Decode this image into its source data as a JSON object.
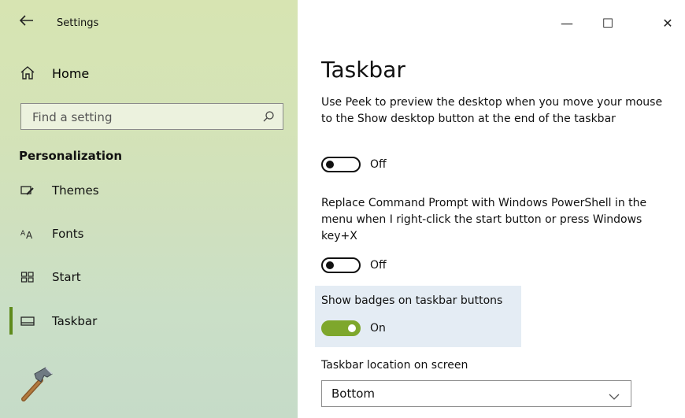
{
  "window": {
    "title": "Settings",
    "controls": {
      "minimize": "—",
      "maximize": "☐",
      "close": "✕"
    }
  },
  "sidebar": {
    "home_label": "Home",
    "search": {
      "placeholder": "Find a setting",
      "value": ""
    },
    "section_title": "Personalization",
    "items": [
      {
        "label": "Themes",
        "icon": "themes-icon"
      },
      {
        "label": "Fonts",
        "icon": "fonts-icon"
      },
      {
        "label": "Start",
        "icon": "start-icon"
      },
      {
        "label": "Taskbar",
        "icon": "taskbar-icon",
        "selected": true
      }
    ]
  },
  "main": {
    "title": "Taskbar",
    "settings": [
      {
        "description": "Use Peek to preview the desktop when you move your mouse to the Show desktop button at the end of the taskbar",
        "state": "Off",
        "on": false
      },
      {
        "description": "Replace Command Prompt with Windows PowerShell in the menu when I right-click the start button or press Windows key+X",
        "state": "Off",
        "on": false
      },
      {
        "description": "Show badges on taskbar buttons",
        "state": "On",
        "on": true
      }
    ],
    "location": {
      "label": "Taskbar location on screen",
      "value": "Bottom"
    }
  },
  "colors": {
    "accent": "#7ea72c",
    "sidebar_bg": "#d4e3b7",
    "highlight": "#e4ecf4"
  }
}
